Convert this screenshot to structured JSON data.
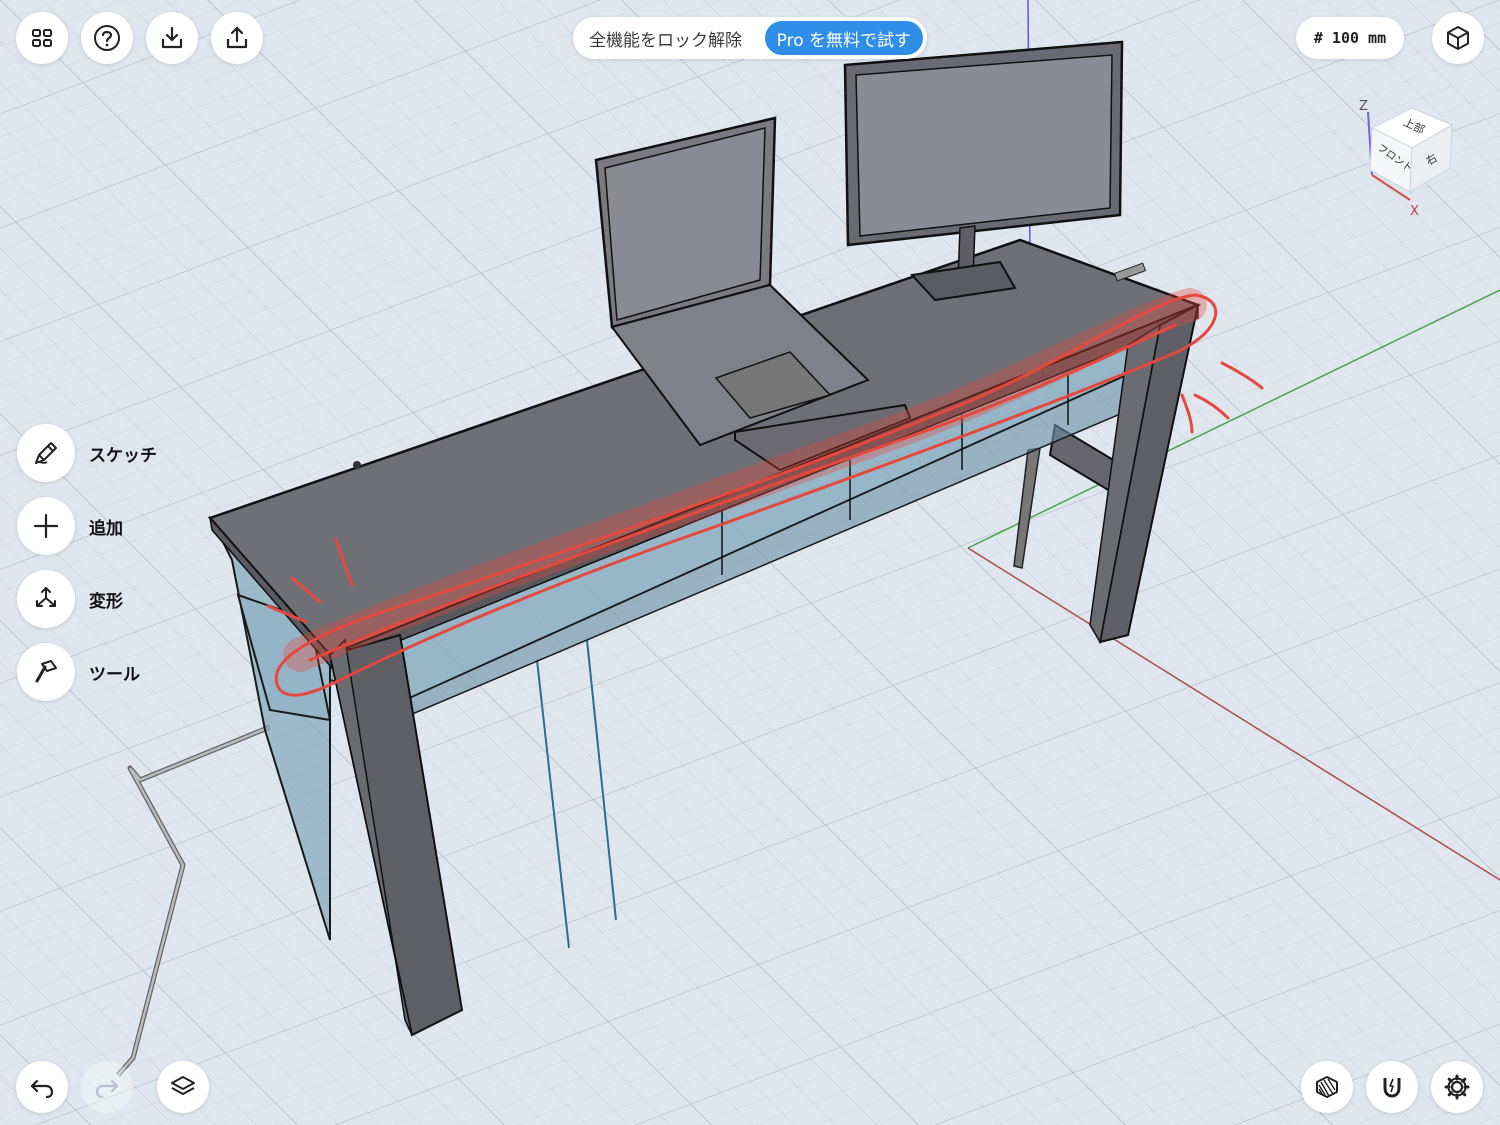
{
  "topbar": {
    "left_buttons": [
      {
        "name": "apps-grid-icon"
      },
      {
        "name": "help-icon"
      },
      {
        "name": "download-icon"
      },
      {
        "name": "share-icon"
      }
    ],
    "unlock_text": "全機能をロック解除",
    "pro_button_label": "Pro を無料で試す",
    "grid_size": "# 100 mm",
    "view_mode_icon": "cube-view-icon"
  },
  "view_cube": {
    "axis_z": "Z",
    "axis_x": "X",
    "face_top": "上部",
    "face_front": "フロント",
    "face_right": "右"
  },
  "tools": [
    {
      "label": "スケッチ",
      "icon": "pen-icon"
    },
    {
      "label": "追加",
      "icon": "plus-icon"
    },
    {
      "label": "変形",
      "icon": "transform-icon"
    },
    {
      "label": "ツール",
      "icon": "hammer-icon"
    }
  ],
  "bottom": {
    "undo_icon": "undo-icon",
    "redo_icon": "redo-icon",
    "layers_icon": "layers-icon",
    "material_icon": "material-icon",
    "snap_icon": "magnet-icon",
    "settings_icon": "gear-icon"
  },
  "colors": {
    "background": "#dfe6ee",
    "grid_line": "#c3ccd6",
    "grid_major": "#aeb9c5",
    "desk_top": "#6f6f76",
    "desk_side": "#5e5e65",
    "glass": "#7fa6ba",
    "annotation": "#e5483c",
    "accent": "#2f8ee8",
    "axis_green": "#4ca24c",
    "axis_red": "#b04a4a",
    "axis_blue": "#5a5ad0"
  }
}
